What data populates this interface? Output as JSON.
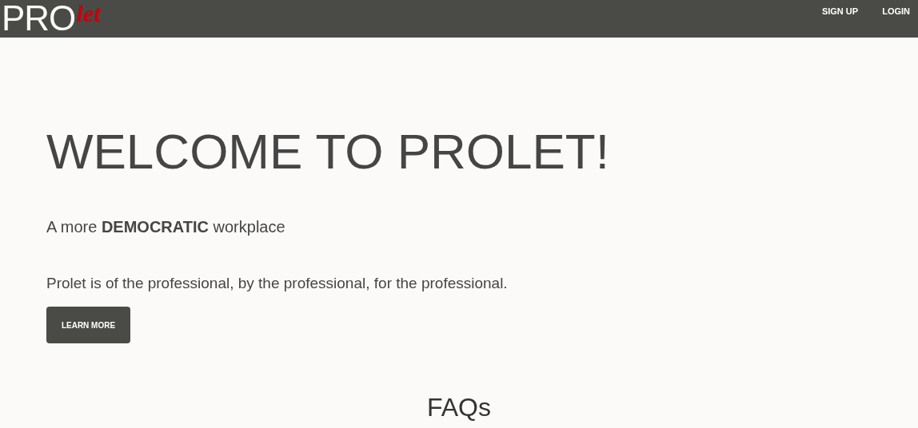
{
  "navbar": {
    "logo": {
      "main": "PRO",
      "accent": "let"
    },
    "links": [
      {
        "label": "SIGN UP"
      },
      {
        "label": "LOGIN"
      }
    ]
  },
  "hero": {
    "title": "WELCOME TO PROLET!",
    "tagline": "A more **DEMOCRATIC** workplace",
    "description": "Prolet is of the professional, by the professional, for the professional.",
    "button": "LEARN MORE"
  },
  "faq": {
    "heading": "FAQs"
  }
}
